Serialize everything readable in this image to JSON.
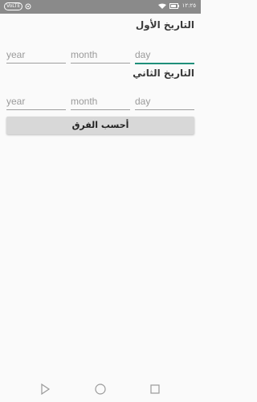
{
  "status_bar": {
    "left_badge": "VoLTE",
    "time": "١٢:٢٥"
  },
  "first_date": {
    "title": "التاريخ الأول",
    "year_placeholder": "year",
    "month_placeholder": "month",
    "day_placeholder": "day"
  },
  "second_date": {
    "title": "التاريخ الثاني",
    "year_placeholder": "year",
    "month_placeholder": "month",
    "day_placeholder": "day"
  },
  "calculate_button": {
    "label": "أحسب الفرق"
  },
  "colors": {
    "accent": "#1f8f7a",
    "status_bar": "#8a8a8a",
    "button": "#d8d8d8"
  },
  "nav_icons": [
    "back-triangle-icon",
    "home-circle-icon",
    "recents-square-icon"
  ]
}
